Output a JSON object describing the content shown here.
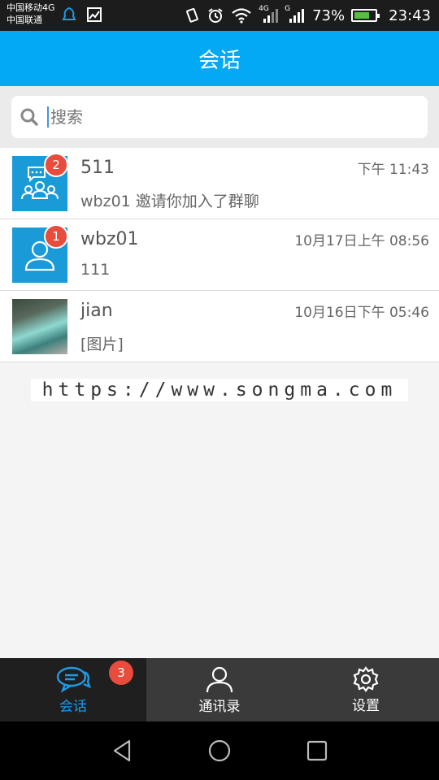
{
  "status_bar": {
    "carrier_1": "中国移动4G",
    "carrier_2": "中国联通",
    "network_label": "4G",
    "network2_label": "G",
    "battery_percent": "73%",
    "battery_level": 0.73,
    "time": "23:43",
    "icons": [
      "notification-icon",
      "image-icon",
      "vibrate-icon",
      "alarm-icon",
      "wifi-icon",
      "signal-icon",
      "signal-icon",
      "battery-icon"
    ]
  },
  "header": {
    "title": "会话"
  },
  "search": {
    "placeholder": "搜索",
    "icon": "search-icon"
  },
  "conversations": [
    {
      "name": "511",
      "time": "下午 11:43",
      "message": "wbz01 邀请你加入了群聊",
      "badge": "2",
      "avatar": "group-icon"
    },
    {
      "name": "wbz01",
      "time": "10月17日上午 08:56",
      "message": "111",
      "badge": "1",
      "avatar": "user-icon"
    },
    {
      "name": "jian",
      "time": "10月16日下午 05:46",
      "message": "[图片]",
      "badge": "",
      "avatar": "photo"
    }
  ],
  "watermark": "https://www.songma.com",
  "tabs": [
    {
      "label": "会话",
      "icon": "chat-icon",
      "badge": "3",
      "active": true
    },
    {
      "label": "通讯录",
      "icon": "contacts-icon",
      "badge": "",
      "active": false
    },
    {
      "label": "设置",
      "icon": "gear-icon",
      "badge": "",
      "active": false
    }
  ],
  "colors": {
    "accent": "#03a9f4",
    "badge": "#e74c3c",
    "active_tab": "#1d9be8",
    "tabbar": "#3a3a3a"
  }
}
